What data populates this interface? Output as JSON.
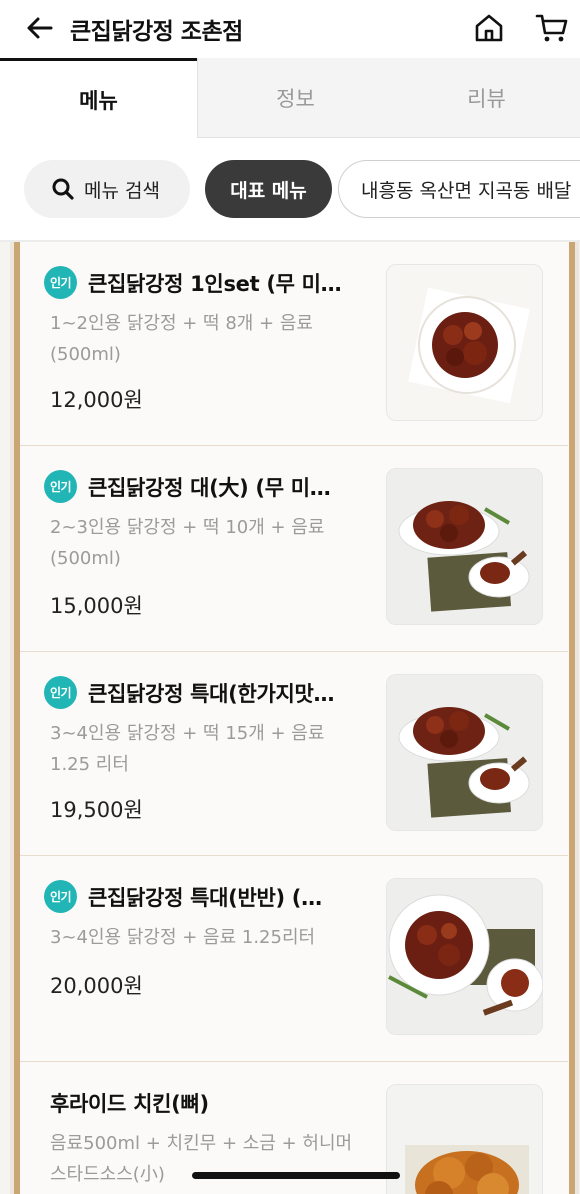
{
  "header": {
    "title": "큰집닭강정 조촌점",
    "back_icon": "arrow-left-icon",
    "home_icon": "home-icon",
    "cart_icon": "cart-icon"
  },
  "tabs": [
    {
      "label": "메뉴",
      "active": true
    },
    {
      "label": "정보",
      "active": false
    },
    {
      "label": "리뷰",
      "active": false
    }
  ],
  "chips": {
    "search_label": "메뉴 검색",
    "representative_label": "대표 메뉴",
    "area_label": "내흥동 옥산면 지곡동 배달"
  },
  "menu_items": [
    {
      "badge": "인기",
      "name": "큰집닭강정 1인set (무 미…",
      "desc": "1~2인용 닭강정 + 떡 8개 + 음료 (500ml)",
      "price": "12,000원"
    },
    {
      "badge": "인기",
      "name": "큰집닭강정 대(大) (무 미…",
      "desc": "2~3인용 닭강정 + 떡 10개 + 음료 (500ml)",
      "price": "15,000원"
    },
    {
      "badge": "인기",
      "name": "큰집닭강정 특대(한가지맛…",
      "desc": "3~4인용 닭강정 + 떡 15개 + 음료 1.25 리터",
      "price": "19,500원"
    },
    {
      "badge": "인기",
      "name": "큰집닭강정 특대(반반) (…",
      "desc": "3~4인용 닭강정 + 음료 1.25리터",
      "price": "20,000원"
    },
    {
      "badge": "",
      "name": "후라이드 치킨(뼈)",
      "desc": "음료500ml + 치킨무 + 소금 + 허니머 스타드소스(小)",
      "price": ""
    }
  ],
  "colors": {
    "badge": "#22b5b5",
    "frame": "#c9a673",
    "active_chip": "#3a3a3a"
  }
}
